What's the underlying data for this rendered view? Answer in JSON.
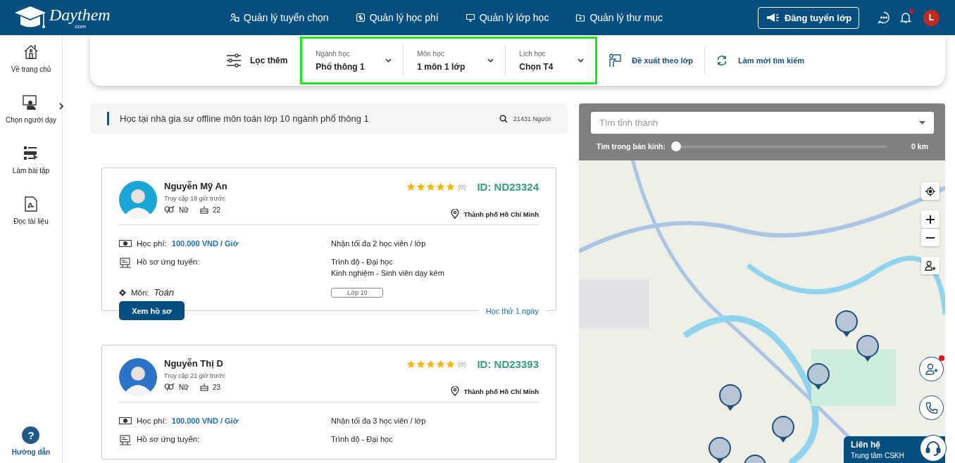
{
  "header": {
    "logo": "Daythem",
    "logo_sub": ".com",
    "nav": [
      "Quản lý tuyển chọn",
      "Quản lý học phí",
      "Quản lý lớp học",
      "Quản lý thư mục"
    ],
    "post_button": "Đăng tuyển lớp",
    "has_unread": true,
    "avatar_letter": "L"
  },
  "sidebar": {
    "items": [
      {
        "label": "Về trang chủ",
        "expandable": false
      },
      {
        "label": "Chọn người dạy",
        "expandable": true
      },
      {
        "label": "Làm bài tập",
        "expandable": false
      },
      {
        "label": "Đọc tài liệu",
        "expandable": false
      }
    ],
    "help_icon": "?",
    "help": "Hướng dẫn"
  },
  "filter": {
    "more_label": "Lọc thêm",
    "selects": [
      {
        "label": "Ngành học",
        "value": "Phổ thông 1"
      },
      {
        "label": "Môn học",
        "value": "1 môn 1 lớp"
      },
      {
        "label": "Lịch học",
        "value": "Chọn T4"
      }
    ],
    "actions": [
      "Đề xuất theo lớp",
      "Làm mới tìm kiếm"
    ]
  },
  "summary": {
    "text": "Học tại nhà gia sư offline môn toán lớp 10 ngành phổ thông 1",
    "count": "21431 Người"
  },
  "tutors": [
    {
      "name": "Nguyễn Mỹ An",
      "last_seen": "Truy cập 18 giờ trước",
      "gender": "Nữ",
      "age": "22",
      "location": "Thành phố Hồ Chí Minh",
      "stars": 5,
      "rating_count": "(0)",
      "id": "ID: ND23324",
      "fee_label": "Học phí:",
      "fee": "100.000 VND / Giờ",
      "capacity": "Nhận tối đa 2 học viên / lớp",
      "profile_label": "Hồ sơ ứng tuyển:",
      "qualifications": [
        "Trình độ - Đại học",
        "Kinh nghiệm - Sinh viên dạy kèm"
      ],
      "subject_label": "Môn:",
      "subject": "Toán",
      "grade_tag": "Lớp 10",
      "view_button": "Xem hồ sơ",
      "trial": "Học thử 1 ngày"
    },
    {
      "name": "Nguyễn Thị D",
      "last_seen": "Truy cập 21 giờ trước",
      "gender": "Nữ",
      "age": "23",
      "location": "Thành phố Hồ Chí Minh",
      "stars": 5,
      "rating_count": "(0)",
      "id": "ID: ND23393",
      "fee_label": "Học phí:",
      "fee": "100.000 VND / Giờ",
      "capacity": "Nhận tối đa 3 học viên / lớp",
      "profile_label": "Hồ sơ ứng tuyển:",
      "qualifications": [
        "Trình độ - Đại học"
      ]
    }
  ],
  "map": {
    "search": {
      "placeholder": "Tìm tỉnh thành"
    },
    "radius_label": "Tìm trong bán kính:",
    "level": 0,
    "radius_value": "0 km"
  },
  "floating": {
    "add_user_unread": true,
    "contact_title": "Liên hệ",
    "contact_subtitle": "Trung tâm CSKH"
  }
}
